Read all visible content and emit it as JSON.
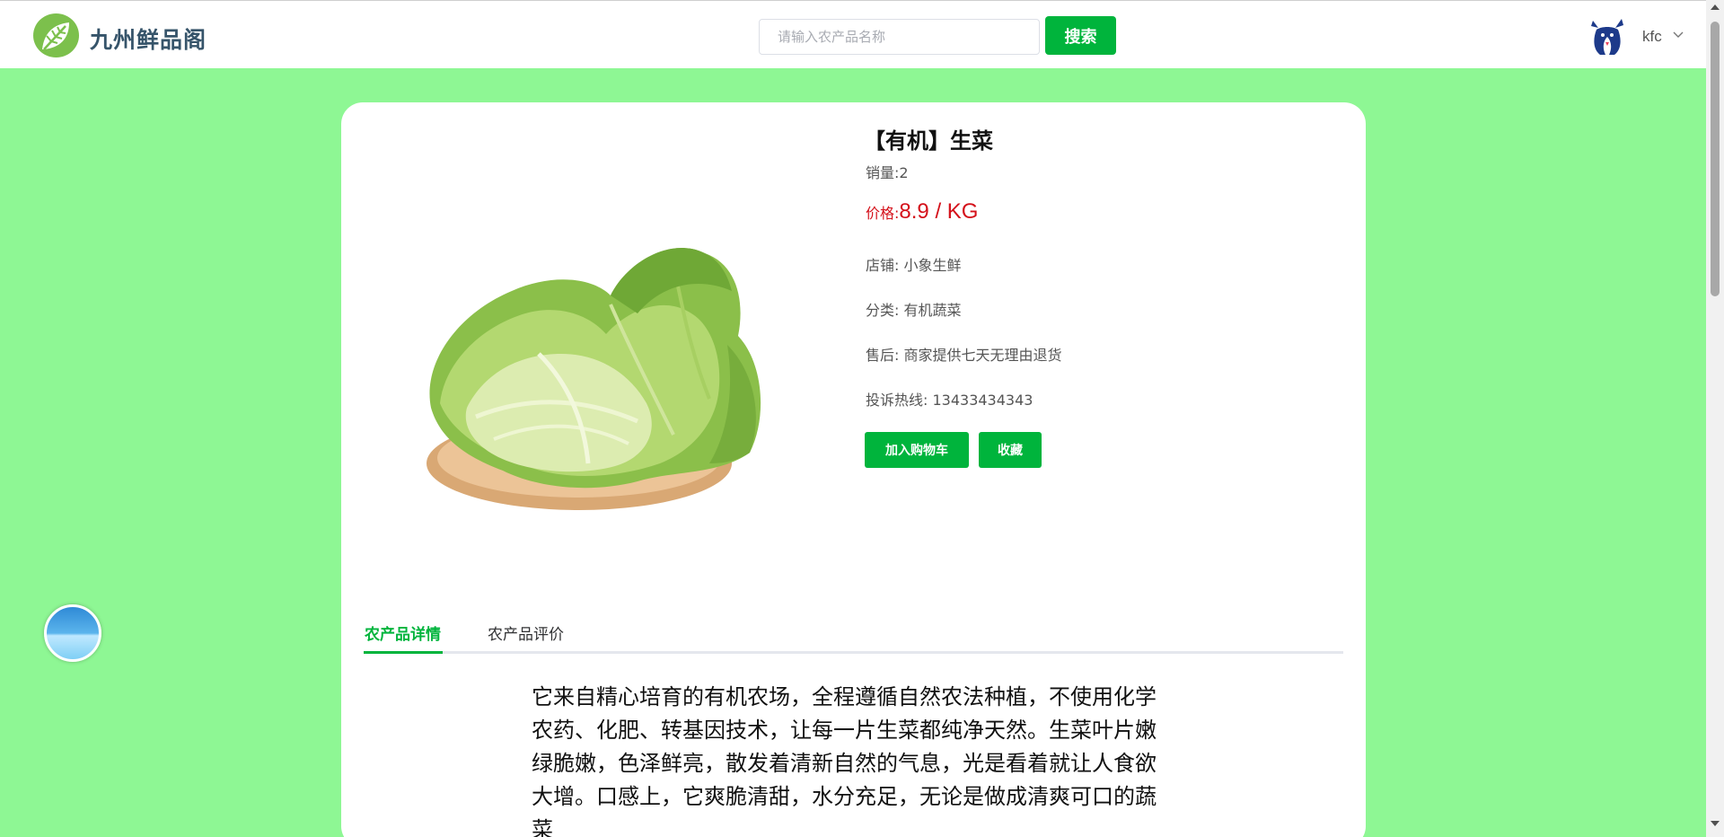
{
  "header": {
    "brand": "九州鲜品阁",
    "search_placeholder": "请输入农产品名称",
    "search_button": "搜索",
    "username": "kfc"
  },
  "product": {
    "title": "【有机】生菜",
    "sales": "销量:2",
    "price_label": "价格:",
    "price_value": "8.9 / KG",
    "shop": "店铺: 小象生鲜",
    "category": "分类: 有机蔬菜",
    "after_sale": "售后: 商家提供七天无理由退货",
    "hotline": "投诉热线: 13433434343",
    "add_to_cart": "加入购物车",
    "favorite": "收藏"
  },
  "tabs": [
    {
      "label": "农产品详情",
      "active": true
    },
    {
      "label": "农产品评价",
      "active": false
    }
  ],
  "description": "它来自精心培育的有机农场，全程遵循自然农法种植，不使用化学农药、化肥、转基因技术，让每一片生菜都纯净天然。生菜叶片嫩绿脆嫩，色泽鲜亮，散发着清新自然的气息，光是看着就让人食欲大增。口感上，它爽脆清甜，水分充足，无论是做成清爽可口的蔬菜",
  "colors": {
    "accent": "#00b43c",
    "page_background": "#8ef794",
    "price": "#d4101a"
  }
}
